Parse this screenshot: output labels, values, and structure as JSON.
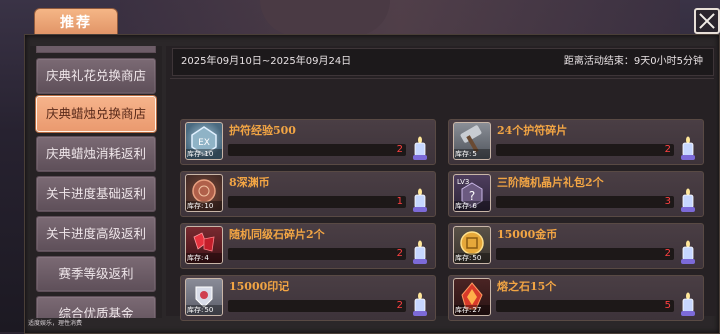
{
  "header": {
    "tab_label": "推荐"
  },
  "sidebar": {
    "items": [
      {
        "label": "庆典礼花兑换商店",
        "active": false
      },
      {
        "label": "庆典蜡烛兑换商店",
        "active": true
      },
      {
        "label": "庆典蜡烛消耗返利",
        "active": false
      },
      {
        "label": "关卡进度基础返利",
        "active": false
      },
      {
        "label": "关卡进度高级返利",
        "active": false
      },
      {
        "label": "赛季等级返利",
        "active": false
      },
      {
        "label": "综合优质基金",
        "active": false
      }
    ]
  },
  "main": {
    "date_range": "2025年09月10日~2025年09月24日",
    "remaining": "距离活动结束：9天0小时5分钟",
    "stock_label": "库存:",
    "items": [
      {
        "name": "护符经验500",
        "stock": "10",
        "price": "2",
        "icon": "ex-gem-icon"
      },
      {
        "name": "24个护符碎片",
        "stock": "5",
        "price": "2",
        "icon": "hammer-icon"
      },
      {
        "name": "8深渊币",
        "stock": "10",
        "price": "1",
        "icon": "abyss-coin-icon"
      },
      {
        "name": "三阶随机晶片礼包2个",
        "stock": "6",
        "price": "3",
        "icon": "mystery-chip-icon"
      },
      {
        "name": "随机同级石碎片2个",
        "stock": "4",
        "price": "2",
        "icon": "red-shard-icon"
      },
      {
        "name": "15000金币",
        "stock": "50",
        "price": "2",
        "icon": "gold-coin-icon"
      },
      {
        "name": "15000印记",
        "stock": "50",
        "price": "2",
        "icon": "mark-icon"
      },
      {
        "name": "熔之石15个",
        "stock": "27",
        "price": "5",
        "icon": "fire-stone-icon"
      }
    ]
  },
  "footer": {
    "text": "适度娱乐，理性消费"
  },
  "colors": {
    "accent": "#ea9a6f",
    "item_name": "#f2a544",
    "price": "#ff4040"
  }
}
